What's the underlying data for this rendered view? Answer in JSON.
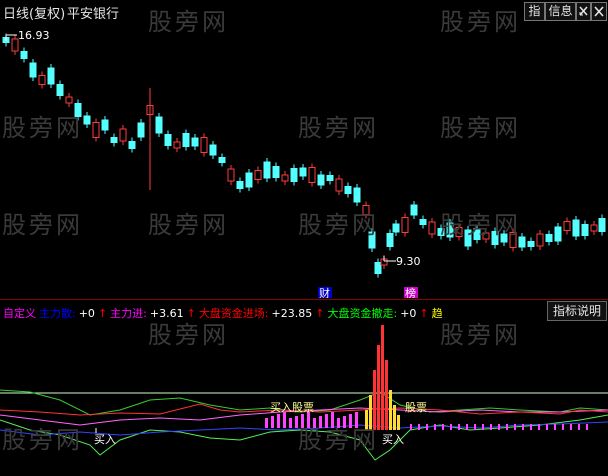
{
  "title": {
    "period": "日线(复权)",
    "stock": "平安银行"
  },
  "toolbar": {
    "indicator_label": "指",
    "info_label": "信息",
    "sell_icon": "arrow-x-icon",
    "close_icon": "close-icon"
  },
  "watermark": "股旁网",
  "upper": {
    "high_label": "16.93",
    "low_label": "9.30",
    "cai_badge": "财",
    "bang_badge": "榜"
  },
  "legend": [
    {
      "text": "自定义",
      "color": "#ff00ff"
    },
    {
      "text": "主力散:",
      "color": "#0000ff"
    },
    {
      "text": "+0",
      "color": "#ffffff"
    },
    {
      "text": "↑",
      "color": "#ff0000"
    },
    {
      "text": "主力进:",
      "color": "#ff00ff"
    },
    {
      "text": "+3.61",
      "color": "#ffffff"
    },
    {
      "text": "↑",
      "color": "#ff0000"
    },
    {
      "text": "大盘资金进场:",
      "color": "#ff0000"
    },
    {
      "text": "+23.85",
      "color": "#ffffff"
    },
    {
      "text": "↑",
      "color": "#ff0000"
    },
    {
      "text": "大盘资金撤走:",
      "color": "#00ff00"
    },
    {
      "text": "+0",
      "color": "#ffffff"
    },
    {
      "text": "↑",
      "color": "#ff0000"
    },
    {
      "text": "趋",
      "color": "#ffff00"
    }
  ],
  "help_button": "指标说明",
  "lower": {
    "buy_label_1": "买入",
    "buy_label_2": "买入",
    "buy_stock_1": "买入股票",
    "buy_stock_2": "股票"
  },
  "colors": {
    "up": "#ff3c3c",
    "down": "#54ffff",
    "bg": "#000000",
    "grid": "#8b0000"
  }
}
